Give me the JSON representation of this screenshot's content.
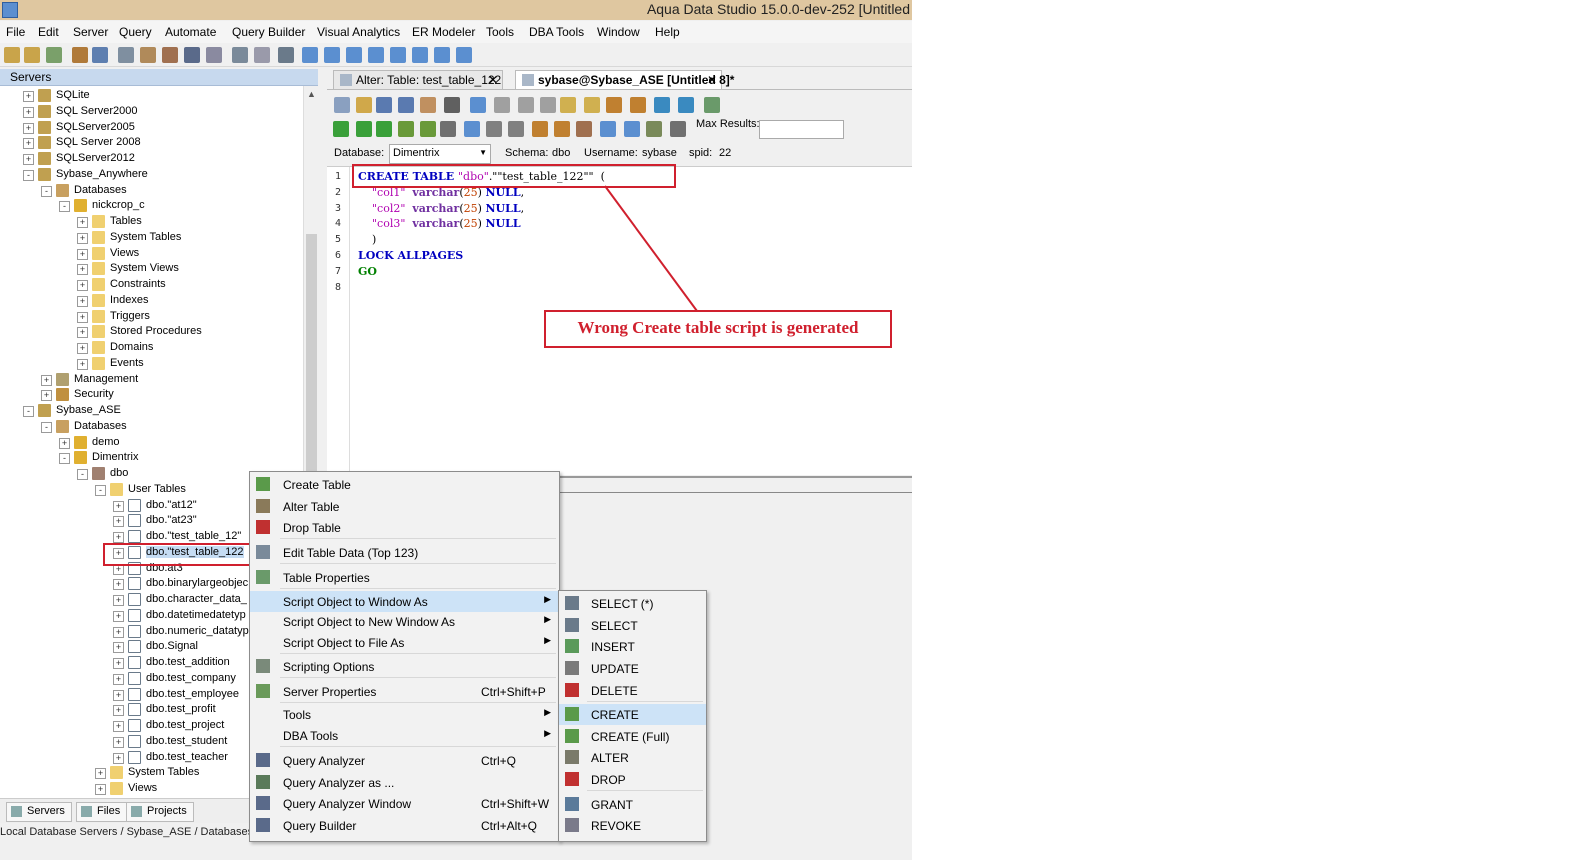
{
  "window": {
    "title": "Aqua Data Studio 15.0.0-dev-252 [Untitled"
  },
  "menubar": [
    "File",
    "Edit",
    "Server",
    "Query",
    "Automate",
    "Query Builder",
    "Visual Analytics",
    "ER Modeler",
    "Tools",
    "DBA Tools",
    "Window",
    "Help"
  ],
  "servers_panel": {
    "title": "Servers",
    "tree": [
      {
        "label": "SQLite",
        "exp": "+",
        "icon": "server-icon"
      },
      {
        "label": "SQL Server2000",
        "exp": "+",
        "icon": "server-icon"
      },
      {
        "label": "SQLServer2005",
        "exp": "+",
        "icon": "server-icon"
      },
      {
        "label": "SQL Server 2008",
        "exp": "+",
        "icon": "server-icon"
      },
      {
        "label": "SQLServer2012",
        "exp": "+",
        "icon": "server-icon"
      },
      {
        "label": "Sybase_Anywhere",
        "exp": "-",
        "icon": "server-icon"
      },
      {
        "label": "Databases",
        "exp": "-",
        "icon": "databases-icon"
      },
      {
        "label": "nickcrop_c",
        "exp": "-",
        "icon": "database-icon"
      },
      {
        "label": "Tables",
        "exp": "+",
        "icon": "folder-icon"
      },
      {
        "label": "System Tables",
        "exp": "+",
        "icon": "folder-icon"
      },
      {
        "label": "Views",
        "exp": "+",
        "icon": "folder-icon"
      },
      {
        "label": "System Views",
        "exp": "+",
        "icon": "folder-icon"
      },
      {
        "label": "Constraints",
        "exp": "+",
        "icon": "folder-icon"
      },
      {
        "label": "Indexes",
        "exp": "+",
        "icon": "folder-icon"
      },
      {
        "label": "Triggers",
        "exp": "+",
        "icon": "folder-icon"
      },
      {
        "label": "Stored Procedures",
        "exp": "+",
        "icon": "folder-icon"
      },
      {
        "label": "Domains",
        "exp": "+",
        "icon": "folder-icon"
      },
      {
        "label": "Events",
        "exp": "+",
        "icon": "folder-icon"
      },
      {
        "label": "Management",
        "exp": "+",
        "icon": "management-icon"
      },
      {
        "label": "Security",
        "exp": "+",
        "icon": "security-icon"
      },
      {
        "label": "Sybase_ASE",
        "exp": "-",
        "icon": "server-icon"
      },
      {
        "label": "Databases",
        "exp": "-",
        "icon": "databases-icon"
      },
      {
        "label": "demo",
        "exp": "+",
        "icon": "database-icon"
      },
      {
        "label": "Dimentrix",
        "exp": "-",
        "icon": "database-icon"
      },
      {
        "label": "dbo",
        "exp": "-",
        "icon": "schema-icon"
      },
      {
        "label": "User Tables",
        "exp": "-",
        "icon": "folder-icon"
      },
      {
        "label": "dbo.\"at12\"",
        "exp": "+",
        "icon": "table-icon"
      },
      {
        "label": "dbo.\"at23\"",
        "exp": "+",
        "icon": "table-icon"
      },
      {
        "label": "dbo.\"test_table_12\"",
        "exp": "+",
        "icon": "table-icon"
      },
      {
        "label": "dbo.\"test_table_122",
        "exp": "+",
        "icon": "table-icon"
      },
      {
        "label": "dbo.at3",
        "exp": "+",
        "icon": "table-icon"
      },
      {
        "label": "dbo.binarylargeobjec",
        "exp": "+",
        "icon": "table-icon"
      },
      {
        "label": "dbo.character_data_",
        "exp": "+",
        "icon": "table-icon"
      },
      {
        "label": "dbo.datetimedatetyp",
        "exp": "+",
        "icon": "table-icon"
      },
      {
        "label": "dbo.numeric_datatyp",
        "exp": "+",
        "icon": "table-icon"
      },
      {
        "label": "dbo.Signal",
        "exp": "+",
        "icon": "table-icon"
      },
      {
        "label": "dbo.test_addition",
        "exp": "+",
        "icon": "table-icon"
      },
      {
        "label": "dbo.test_company",
        "exp": "+",
        "icon": "table-icon"
      },
      {
        "label": "dbo.test_employee",
        "exp": "+",
        "icon": "table-icon"
      },
      {
        "label": "dbo.test_profit",
        "exp": "+",
        "icon": "table-icon"
      },
      {
        "label": "dbo.test_project",
        "exp": "+",
        "icon": "table-icon"
      },
      {
        "label": "dbo.test_student",
        "exp": "+",
        "icon": "table-icon"
      },
      {
        "label": "dbo.test_teacher",
        "exp": "+",
        "icon": "table-icon"
      },
      {
        "label": "System Tables",
        "exp": "+",
        "icon": "folder-icon"
      },
      {
        "label": "Views",
        "exp": "+",
        "icon": "folder-icon"
      }
    ],
    "bottom_tabs": [
      "Servers",
      "Files",
      "Projects"
    ],
    "status_path": "Local Database Servers / Sybase_ASE / Databases /"
  },
  "doc_tabs": [
    {
      "label": "Alter: Table: test_table_122"
    },
    {
      "label": "sybase@Sybase_ASE [Untitled 8]*"
    }
  ],
  "query_toolbar": {
    "max_results_label": "Max Results:",
    "max_results_value": "",
    "database_label": "Database:",
    "database_value": "Dimentrix",
    "schema_label": "Schema:",
    "schema_value": "dbo",
    "username_label": "Username:",
    "username_value": "sybase",
    "spid_label": "spid:",
    "spid_value": "22"
  },
  "editor": {
    "line_numbers": [
      "1",
      "2",
      "3",
      "4",
      "5",
      "6",
      "7",
      "8"
    ],
    "lines": [
      [
        {
          "t": "CREATE TABLE ",
          "c": "kw"
        },
        {
          "t": "\"dbo\"",
          "c": "str"
        },
        {
          "t": ".\"\"test_table_122\"\"  (",
          "c": ""
        }
      ],
      [
        {
          "t": "    \"col1\"  ",
          "c": "str"
        },
        {
          "t": "varchar",
          "c": "typ"
        },
        {
          "t": "(",
          "c": ""
        },
        {
          "t": "25",
          "c": "num"
        },
        {
          "t": ") ",
          "c": ""
        },
        {
          "t": "NULL",
          "c": "kw"
        },
        {
          "t": ",",
          "c": ""
        }
      ],
      [
        {
          "t": "    \"col2\"  ",
          "c": "str"
        },
        {
          "t": "varchar",
          "c": "typ"
        },
        {
          "t": "(",
          "c": ""
        },
        {
          "t": "25",
          "c": "num"
        },
        {
          "t": ") ",
          "c": ""
        },
        {
          "t": "NULL",
          "c": "kw"
        },
        {
          "t": ",",
          "c": ""
        }
      ],
      [
        {
          "t": "    \"col3\"  ",
          "c": "str"
        },
        {
          "t": "varchar",
          "c": "typ"
        },
        {
          "t": "(",
          "c": ""
        },
        {
          "t": "25",
          "c": "num"
        },
        {
          "t": ") ",
          "c": ""
        },
        {
          "t": "NULL",
          "c": "kw"
        }
      ],
      [
        {
          "t": "    )",
          "c": ""
        }
      ],
      [
        {
          "t": "LOCK ALLPAGES",
          "c": "kw"
        }
      ],
      [
        {
          "t": "GO",
          "c": "go"
        }
      ],
      []
    ]
  },
  "annotation": "Wrong Create table script is generated",
  "context_menu": [
    {
      "label": "Create Table",
      "icon": "create-table-icon"
    },
    {
      "label": "Alter Table",
      "icon": "alter-table-icon"
    },
    {
      "label": "Drop Table",
      "icon": "drop-table-icon",
      "sep_after": true
    },
    {
      "label": "Edit Table Data (Top 123)",
      "icon": "edit-data-icon",
      "sep_after": true
    },
    {
      "label": "Table Properties",
      "icon": "properties-icon",
      "sep_after": true
    },
    {
      "label": "Script Object to Window As",
      "arrow": true,
      "highlight": true
    },
    {
      "label": "Script Object to New Window As",
      "arrow": true
    },
    {
      "label": "Script Object to File As",
      "arrow": true,
      "sep_after": true
    },
    {
      "label": "Scripting Options",
      "icon": "scripting-options-icon",
      "sep_after": true
    },
    {
      "label": "Server Properties",
      "icon": "server-properties-icon",
      "shortcut": "Ctrl+Shift+P",
      "sep_after": true
    },
    {
      "label": "Tools",
      "arrow": true
    },
    {
      "label": "DBA Tools",
      "arrow": true,
      "sep_after": true
    },
    {
      "label": "Query Analyzer",
      "icon": "query-analyzer-icon",
      "shortcut": "Ctrl+Q"
    },
    {
      "label": "Query Analyzer as ...",
      "icon": "query-analyzer-as-icon"
    },
    {
      "label": "Query Analyzer Window",
      "icon": "query-analyzer-window-icon",
      "shortcut": "Ctrl+Shift+W"
    },
    {
      "label": "Query Builder",
      "icon": "query-builder-icon",
      "shortcut": "Ctrl+Alt+Q"
    }
  ],
  "submenu": [
    {
      "label": "SELECT (*)",
      "icon": "select-all-icon"
    },
    {
      "label": "SELECT",
      "icon": "select-icon"
    },
    {
      "label": "INSERT",
      "icon": "insert-icon"
    },
    {
      "label": "UPDATE",
      "icon": "update-icon"
    },
    {
      "label": "DELETE",
      "icon": "delete-icon",
      "sep_after": true
    },
    {
      "label": "CREATE",
      "icon": "create-icon",
      "highlight": true
    },
    {
      "label": "CREATE (Full)",
      "icon": "create-full-icon"
    },
    {
      "label": "ALTER",
      "icon": "alter-icon"
    },
    {
      "label": "DROP",
      "icon": "drop-icon",
      "sep_after": true
    },
    {
      "label": "GRANT",
      "icon": "grant-icon"
    },
    {
      "label": "REVOKE",
      "icon": "revoke-icon"
    }
  ],
  "colors": {
    "highlight_box": "#d0202e",
    "menu_highlight": "#cde3f7",
    "titlebar": "#dfc7a0"
  }
}
